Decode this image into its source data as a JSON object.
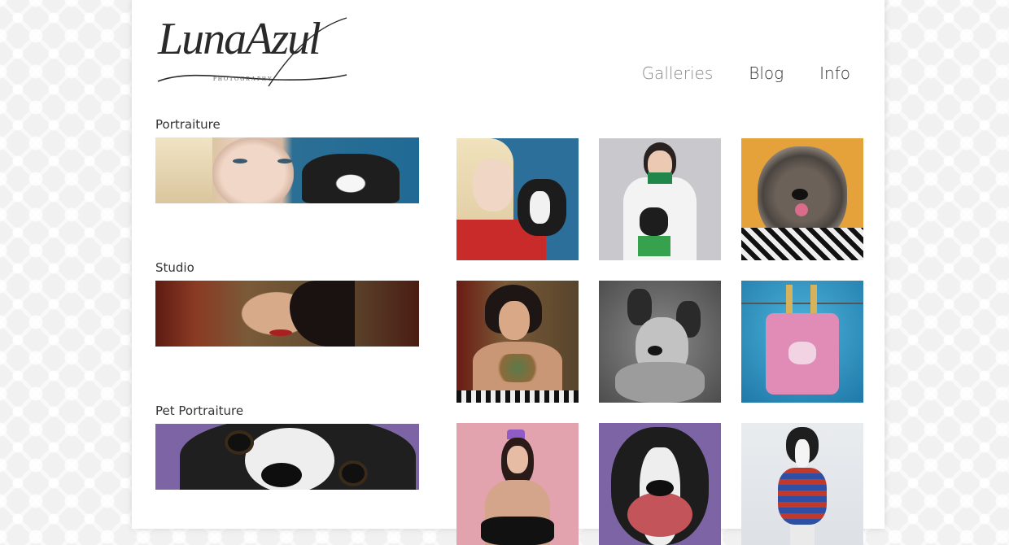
{
  "brand": {
    "logo_text": "LunaAzul",
    "logo_sub": "PHOTOGRAPHY"
  },
  "nav": {
    "items": [
      {
        "label": "Galleries",
        "active": true
      },
      {
        "label": "Blog",
        "active": false
      },
      {
        "label": "Info",
        "active": false
      }
    ]
  },
  "categories": [
    {
      "label": "Portraiture"
    },
    {
      "label": "Studio"
    },
    {
      "label": "Pet Portraiture"
    }
  ],
  "colors": {
    "page_bg": "#ffffff",
    "nav_active": "#8a8a8a",
    "nav_text": "#333333"
  }
}
